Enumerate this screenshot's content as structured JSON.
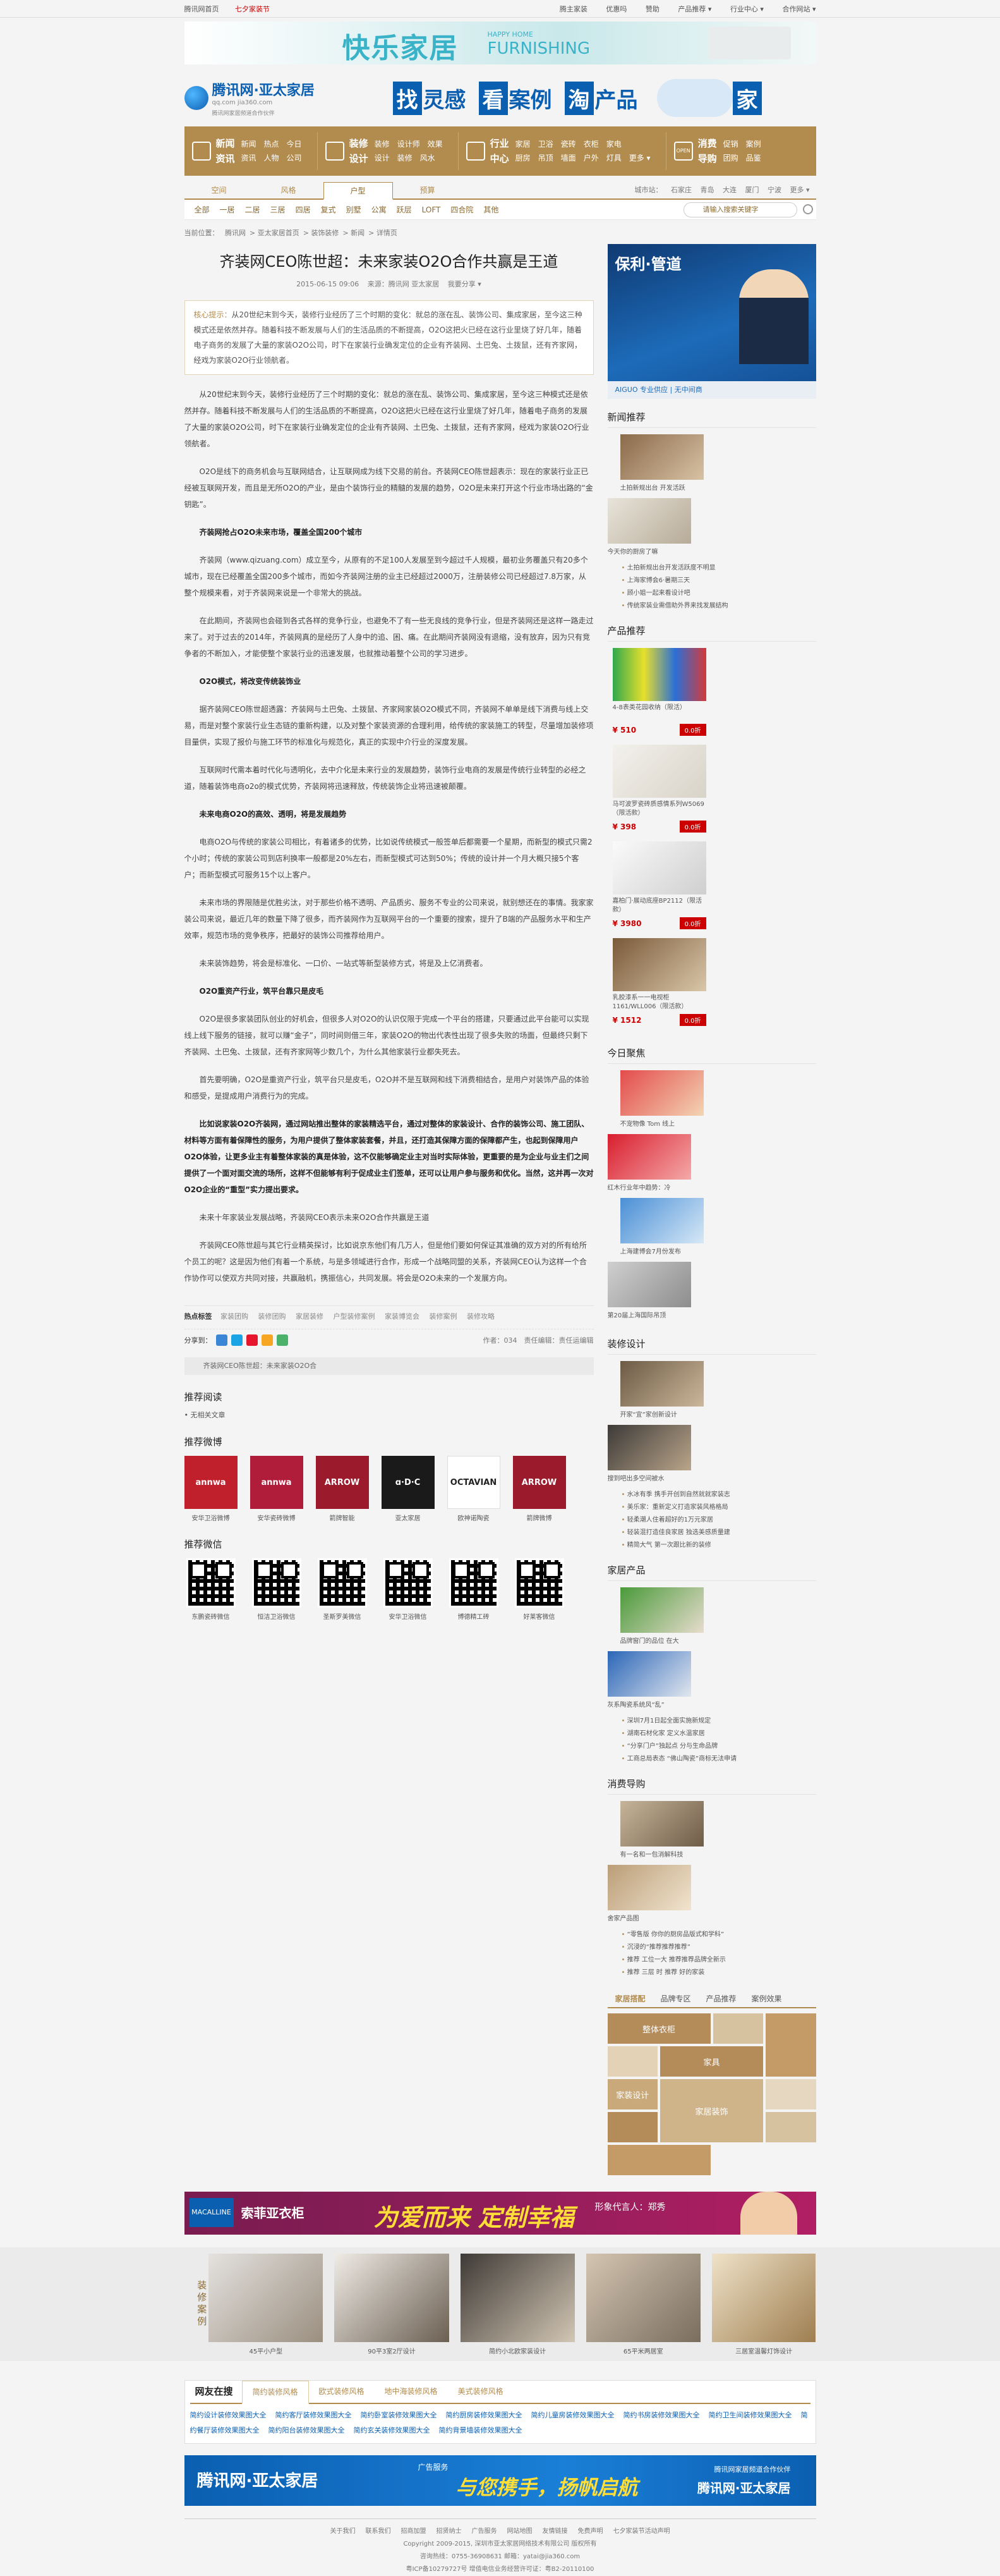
{
  "topbar": {
    "left": [
      "腾讯网首页",
      "七夕家装节"
    ],
    "right": [
      "腾主家装",
      "优惠吗",
      "赞助",
      "产品推荐 ▾",
      "行业中心 ▾",
      "合作网站 ▾"
    ]
  },
  "banner": {
    "title": "快乐家居",
    "en_top": "HAPPY HOME",
    "en_main": "FURNISHING"
  },
  "logo": {
    "name": "腾讯网·亚太家居",
    "domain": "qq.com  jia360.com",
    "tagline": "腾讯网家居频道合作伙伴"
  },
  "slogan": {
    "a_box": "找",
    "a_word": "灵感",
    "b_box": "看",
    "b_word": "案例",
    "c_box": "淘",
    "c_word": "产品",
    "d_box": "家"
  },
  "nav": [
    {
      "head": [
        "新闻",
        "资讯"
      ],
      "links": [
        [
          "新闻",
          "热点",
          "今日"
        ],
        [
          "资讯",
          "人物",
          "公司"
        ]
      ]
    },
    {
      "head": [
        "装修",
        "设计"
      ],
      "links": [
        [
          "装修",
          "设计师",
          "效果"
        ],
        [
          "设计",
          "装修",
          "风水"
        ]
      ]
    },
    {
      "head": [
        "行业",
        "中心"
      ],
      "links": [
        [
          "家居",
          "卫浴",
          "瓷砖",
          "衣柜",
          "家电"
        ],
        [
          "厨房",
          "吊顶",
          "墙面",
          "户外",
          "灯具",
          "更多 ▾"
        ]
      ]
    },
    {
      "head": [
        "消费",
        "导购"
      ],
      "links": [
        [
          "促销",
          "案例"
        ],
        [
          "团购",
          "品鉴"
        ]
      ]
    }
  ],
  "nav_open": "OPEN",
  "subtabs": [
    "空间",
    "风格",
    "户型",
    "预算"
  ],
  "subtab_active": "户型",
  "cityline": [
    "城市站：",
    "石家庄",
    "青岛",
    "大连",
    "厦门",
    "宁波",
    "更多 ▾"
  ],
  "filters": [
    "全部",
    "一居",
    "二居",
    "三居",
    "四居",
    "复式",
    "别墅",
    "公寓",
    "跃层",
    "LOFT",
    "四合院",
    "其他"
  ],
  "search": {
    "placeholder": "请输入搜索关键字"
  },
  "crumb": [
    "当前位置：",
    "腾讯网",
    "亚太家居首页",
    "装饰装修",
    "新闻",
    "详情页"
  ],
  "article": {
    "title": "齐装网CEO陈世超：未来家装O2O合作共赢是王道",
    "date": "2015-06-15 09:06",
    "source": "来源：腾讯网 亚太家居",
    "share": "我要分享 ▾",
    "summary_label": "核心提示：",
    "summary": "从20世纪末到今天，装修行业经历了三个时期的变化：就总的涨在乱、装饰公司、集成家居，至今这三种模式还是依然并存。随着科技不断发展与人们的生活品质的不断提高，O2O这把火已经在这行业里烧了好几年，随着电子商务的发展了大量的家装O2O公司，时下在家装行业确发定位的企业有齐装网、土巴兔、土拨鼠，还有齐家网，经戏为家装O2O行业领航者。",
    "paras": [
      "从20世纪末到今天，装修行业经历了三个时期的变化：就总的涨在乱、装饰公司、集成家居，至今这三种模式还是依然并存。随着科技不断发展与人们的生活品质的不断提高，O2O这把火已经在这行业里烧了好几年，随着电子商务的发展了大量的家装O2O公司，时下在家装行业确发定位的企业有齐装网、土巴兔、土拨鼠，还有齐家网，经戏为家装O2O行业领航者。",
      "O2O是线下的商务机会与互联网结合，让互联网成为线下交易的前台。齐装网CEO陈世超表示：现在的家装行业正已经被互联网开发，而且是无所O2O的产业，是由个装饰行业的精髓的发展的趋势，O2O是未来打开这个行业市场出路的“金钥匙”。",
      "齐装网抢占O2O未来市场，覆盖全国200个城市",
      "齐装网（www.qizuang.com）成立至今，从原有的不足100人发展至到今超过千人规模，最初业务覆盖只有20多个城市，现在已经覆盖全国200多个城市，而如今齐装网注册的业主已经超过2000万，注册装修公司已经超过7.8万家，从整个规模来看，对于齐装网来说是一个非常大的挑战。",
      "在此期间，齐装网也会碰到各式各样的竞争行业，也避免不了有一些无良线的竞争行业，但是齐装网还是这样一路走过来了。对于过去的2014年，齐装网真的是经历了人身中的追、困、痛。在此期间齐装网没有退缩，没有放弃，因为只有竞争者的不断加入，才能使整个家装行业的迅速发展，也就推动着整个公司的学习进步。",
      "O2O模式，将改变传统装饰业",
      "据齐装网CEO陈世超透露：齐装网与土巴兔、土拨鼠、齐家网家装O2O模式不同，齐装网不单单是线下消费与线上交易，而是对整个家装行业生态链的重新构建，以及对整个家装资源的合理利用，给传统的家装施工的转型，尽量增加装修项目量供，实现了报价与施工环节的标准化与规范化，真正的实现中介行业的深度发展。",
      "互联网时代需本着时代化与透明化，去中介化是未来行业的发展趋势，装饰行业电商的发展是传统行业转型的必经之道，随着装饰电商o2o的模式优势，齐装网将迅速释放，传统装饰企业将迅速被颠覆。",
      "未来电商O2O的高效、透明，将是发展趋势",
      "电商O2O与传统的家装公司相比，有着诸多的优势，比如说传统模式一般签单后都需要一个星期，而新型的模式只需2个小时；传统的家装公司到店利换率一般都是20%左右，而新型模式可达到50%；传统的设计并一个月大概只接5个客户；而新型模式可服务15个以上客户。",
      "未来市场的界限随是优胜劣汰，对于那些价格不透明、产品质劣、服务不专业的公司来说，就别想还在的事情。我家家装公司来说，最近几年的数量下降了很多，而齐装网作为互联网平台的一个重要的搜索，提升了B端的产品服务水平和生产效率，规范市场的竞争秩序，把最好的装饰公司推荐给用户。",
      "未来装饰趋势，将会是标准化、一口价、一站式等新型装修方式，将是及上亿消费者。",
      "O2O重资产行业，筑平台靠只是皮毛",
      "O2O是很多家装团队创业的好机会，但很多人对O2O的认识仅限于完成一个平台的搭建，只要通过此平台能可以实现线上线下服务的链接，就可以赚“金子”，同时间则借三年，家装O2O的物出代表性出现了很多失败的场面，但最终只剩下齐装网、土巴兔、土拨鼠，还有齐家网等少数几个，为什么其他家装行业都失死去。",
      "首先要明确，O2O是重资产行业，筑平台只是皮毛，O2O并不是互联网和线下消费相结合，是用户对装饰产品的体验和感受，是提成用户消费行为的完成。",
      "比如说家装O2O齐装网，通过网站推出整体的家装精选平台，通过对整体的家装设计、合作的装饰公司、施工团队、材料等方面有着保障性的服务，为用户提供了整体家装套餐，并且，还打造其保障方面的保障都产生，也起到保障用户O2O体验，让更多业主有着整体家装的真是体验，这不仅能够确定业主对当时实际体验，更重要的是为企业与业主们之间提供了一个面对面交流的场所，这样不但能够有利于促成业主们签单，还可以让用户参与服务和优化。当然，这并再一次对O2O企业的“重型”实力提出要求。",
      "未来十年家装业发展战略，齐装网CEO表示未来O2O合作共赢是王道",
      "齐装网CEO陈世超与其它行业精英探讨，比如说京东他们有几万人，但是他们要如何保证其准确的双方对的所有给所个员工的呢？这是因为他们有着一个系统，与是多领域进行合作，形成一个战略同盟的关系，齐装网CEO认为这样一个合作协作可以使双方共同对接，共赢融机，携振信心，共同发展。将会是O2O未来的一个发展方向。"
    ],
    "bold_idx": [
      2,
      5,
      8,
      12,
      15
    ]
  },
  "tags": {
    "label": "热点标签",
    "items": [
      "家装团购",
      "装修团购",
      "家居装修",
      "户型装修案例",
      "家装博览会",
      "装修案例",
      "装修攻略"
    ]
  },
  "share": {
    "label": "分享到：",
    "author": "作者：034",
    "editor": "责任编辑：责任运编辑"
  },
  "quote": "齐装网CEO陈世超：未来家装O2O合",
  "related": {
    "title": "推荐阅读",
    "items": [
      "• 无相关文章"
    ]
  },
  "weibo": {
    "title": "推荐微博",
    "items": [
      {
        "name": "安华卫浴微博",
        "mark": "annwa",
        "bg": "#c0202b"
      },
      {
        "name": "安华瓷砖微博",
        "mark": "annwa",
        "bg": "#b01d3b"
      },
      {
        "name": "箭牌智能",
        "mark": "ARROW",
        "bg": "#9b1a2b"
      },
      {
        "name": "亚太家居",
        "mark": "ɑ·D·C",
        "bg": "#1a1a1a"
      },
      {
        "name": "欧神诺陶瓷",
        "mark": "OCTAVIAN",
        "bg": "#ffffff"
      },
      {
        "name": "箭牌微博",
        "mark": "ARROW",
        "bg": "#9b1a2b"
      }
    ]
  },
  "weixin": {
    "title": "推荐微信",
    "items": [
      "东鹏瓷砖微信",
      "恒洁卫浴微信",
      "圣斯罗美微信",
      "安华卫浴微信",
      "博德精工砖",
      "好莱客微信"
    ]
  },
  "right": {
    "ad": {
      "brand": "保利·管道",
      "bottom": "AIGUO  专业供应 | 无中间商"
    },
    "news": {
      "title": "新闻推荐",
      "thumbs": [
        "土拍新规出台 开发活跃",
        "今天你的厨房了嘛"
      ],
      "list": [
        "土拍新规出台开发活跃度不明显",
        "上海家博会6·暑期三天",
        "顾小姐一起来看设计吧",
        "传统家装业需借助外界来找发展结构"
      ]
    },
    "prod": {
      "title": "产品推荐",
      "items": [
        {
          "name": "4-8表类花园收纳（限活）",
          "price": "¥ 510",
          "btn": "0.0折"
        },
        {
          "name": "马可波罗瓷砖质感情系列W5069（限活款）",
          "price": "¥ 398",
          "btn": "0.0折"
        },
        {
          "name": "嘉柏门·展动底座BP2112（限活款）",
          "price": "¥ 3980",
          "btn": "0.0折"
        },
        {
          "name": "乳胶漆系一一电视柜1161/WLL006（限活款）",
          "price": "¥ 1512",
          "btn": "0.0折"
        }
      ]
    },
    "focus": {
      "title": "今日聚焦",
      "thumbs": [
        "不宠物像 Tom 线上",
        "红木行业年中趋势：冷",
        "上海建博会7月份发布",
        "第20届上海国际吊顶"
      ]
    },
    "design": {
      "title": "装修设计",
      "thumbs": [
        "开家“宜”家创新设计",
        "搜到吧出多空间被水"
      ],
      "list": [
        "水冰有季 携手开创到自然就就家装志",
        "美乐家：重新定义打造家装风格格局",
        "轻柔潮人住着超好的1万元家居",
        "轻装混打造佳良家居 独选美感质量建",
        "精简大气 第一次跟比新的装修"
      ]
    },
    "home": {
      "title": "家居产品",
      "thumbs": [
        "品牌窗门的品位 在大",
        "灰系陶瓷系统风“乱”"
      ],
      "list": [
        "深圳7月1日起全面实施新规定",
        "湖南石材化家 定义水温家居",
        "“分享门户”独起点 分与生命品牌",
        "工商总局表态 “佛山陶瓷”商标无法申请"
      ]
    },
    "shop": {
      "title": "消费导购",
      "thumbs": [
        "有一名和一包消解科技",
        "舍家产品图"
      ],
      "list": [
        "“零售版 你你的厨房品版式和学科”",
        "沉浸的“推荐推荐推荐”",
        "推荐 工位一大 推荐推荐品牌全新示",
        "推荐 三层 时 推荐 好的家装"
      ]
    },
    "tabs": [
      "家居搭配",
      "品牌专区",
      "产品推荐",
      "案例效果"
    ],
    "mosaic": [
      "整体衣柜",
      "",
      "家具",
      "家居装饰",
      "家装设计",
      "",
      "",
      ""
    ]
  },
  "bigad": {
    "b1": "MACALLINE",
    "b2": "索菲亚衣柜",
    "b3": "为爱而来  定制幸福",
    "b4": "形象代言人：郑秀"
  },
  "cases": {
    "label": "装修案例",
    "items": [
      "45平小户型",
      "90平3室2厅设计",
      "简约小北欧家装设计",
      "65平米两居室",
      "三居室温馨灯饰设计"
    ]
  },
  "friends": {
    "head": "网友在搜",
    "tabs": [
      "简约装修风格",
      "欧式装修风格",
      "地中海装修风格",
      "美式装修风格"
    ],
    "links": [
      "简约设计装修效果图大全",
      "简约客厅装修效果图大全",
      "简约卧室装修效果图大全",
      "简约厨房装修效果图大全",
      "简约儿童房装修效果图大全",
      "简约书房装修效果图大全",
      "简约卫生间装修效果图大全",
      "简约餐厅装修效果图大全",
      "简约阳台装修效果图大全",
      "简约玄关装修效果图大全",
      "简约背景墙装修效果图大全"
    ]
  },
  "footad": {
    "f1": "腾讯网·亚太家居",
    "f2": "广告服务",
    "f3": "与您携手，扬帆启航",
    "f4": "腾讯网家居频道合作伙伴",
    "f5": "腾讯网·亚太家居"
  },
  "footer": {
    "nav": [
      "关于我们",
      "联系我们",
      "招商加盟",
      "招贤纳士",
      "广告服务",
      "网站地图",
      "友情链接",
      "免费声明",
      "七夕家装节活动声明"
    ],
    "lines": [
      "Copyright 2009-2015, 深圳市亚太家居网络技术有限公司 版权所有",
      "咨询热线：0755-36908631 邮箱：yatai@jia360.com",
      "粤ICP备10279727号  增值电信业务经营许可证：粤B2-20110100"
    ]
  }
}
